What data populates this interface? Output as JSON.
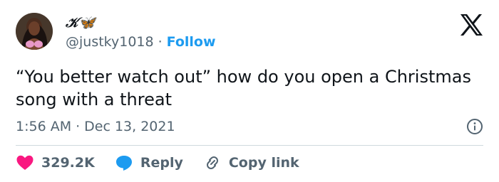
{
  "author": {
    "display_name": "𝒦🦋",
    "handle": "@justky1018",
    "follow_label": "Follow"
  },
  "tweet": {
    "text": "“You better watch out” how do you open a Christmas song with a threat",
    "time": "1:56 AM",
    "date": "Dec 13, 2021"
  },
  "actions": {
    "likes_count": "329.2K",
    "reply_label": "Reply",
    "copy_link_label": "Copy link"
  },
  "separator": "·",
  "icons": {
    "brand": "x-logo-icon",
    "info": "info-icon",
    "like": "heart-icon",
    "reply": "speech-bubble-icon",
    "link": "link-icon"
  },
  "colors": {
    "accent": "#1d9bf0",
    "like": "#f91880",
    "muted_text": "#536471",
    "main_text": "#0f1419"
  }
}
